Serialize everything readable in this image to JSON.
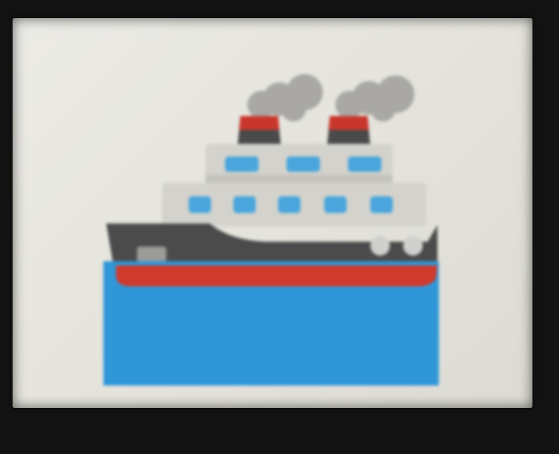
{
  "scene": {
    "subject": "ship-emoji-illustration",
    "colors": {
      "bezel": "#141313",
      "screen": "#e8e7e1",
      "smoke": "#a9a8a4",
      "funnel_band": "#c9362c",
      "funnel_body": "#4a4a4a",
      "cabin": "#d3d2cc",
      "cabin_shade": "#c4c3bd",
      "window": "#4aa6dc",
      "hull": "#4b4b4b",
      "hull_stripe": "#cf3a2d",
      "porthole": "#cfcfcd",
      "water": "#2f97d8"
    }
  }
}
